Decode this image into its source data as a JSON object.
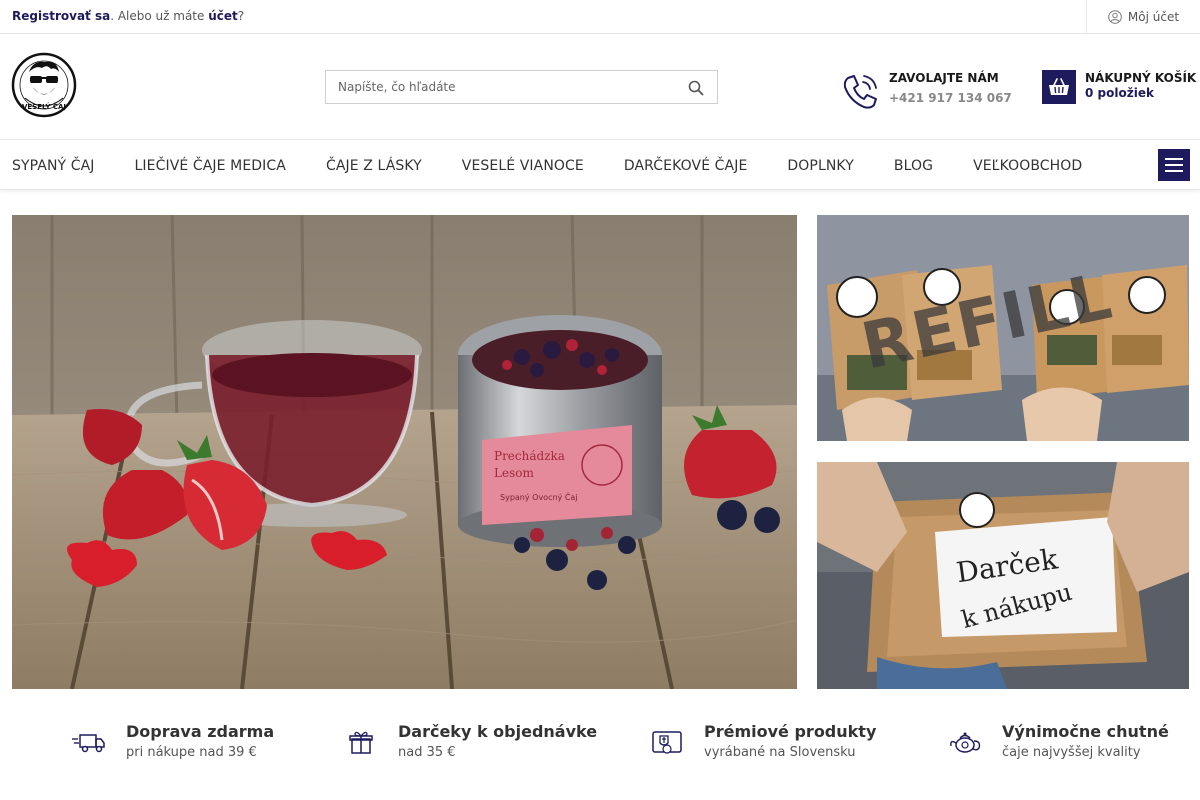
{
  "topbar": {
    "register_link": "Registrovať sa",
    "already_text": ". Alebo už máte ",
    "account_link": "účet",
    "qmark": "?",
    "my_account": "Môj účet"
  },
  "header": {
    "logo_text": "VESELÝ ČAJ",
    "search_placeholder": "Napíšte, čo hľadáte",
    "call_title": "ZAVOLAJTE NÁM",
    "call_number": "+421 917 134 067",
    "cart_title": "NÁKUPNÝ KOŠÍK",
    "cart_count": "0 položiek"
  },
  "nav": {
    "items": [
      "SYPANÝ ČAJ",
      "LIEČIVÉ ČAJE MEDICA",
      "ČAJE Z LÁSKY",
      "VESELÉ VIANOCE",
      "DARČEKOVÉ ČAJE",
      "DOPLNKY",
      "BLOG",
      "VEĽKOOBCHOD"
    ]
  },
  "banners": {
    "hero_can_label_1": "Prechádzka",
    "hero_can_label_2": "Lesom",
    "hero_can_label_3": "Sypaný Ovocný Čaj",
    "side1_text": "REFILL",
    "side2_note_1": "Darček",
    "side2_note_2": "k nákupu"
  },
  "features": [
    {
      "title": "Doprava zdarma",
      "subtitle": "pri nákupe nad 39 €",
      "icon": "truck-icon"
    },
    {
      "title": "Darčeky k objednávke",
      "subtitle": "nad 35 €",
      "icon": "gift-icon"
    },
    {
      "title": "Prémiové produkty",
      "subtitle": "vyrábané na Slovensku",
      "icon": "sk-badge-icon"
    },
    {
      "title": "Výnimočne chutné",
      "subtitle": "čaje najvyššej kvality",
      "icon": "teapot-icon"
    }
  ],
  "colors": {
    "brand": "#1d1b5e",
    "border": "#e6e6e6"
  }
}
